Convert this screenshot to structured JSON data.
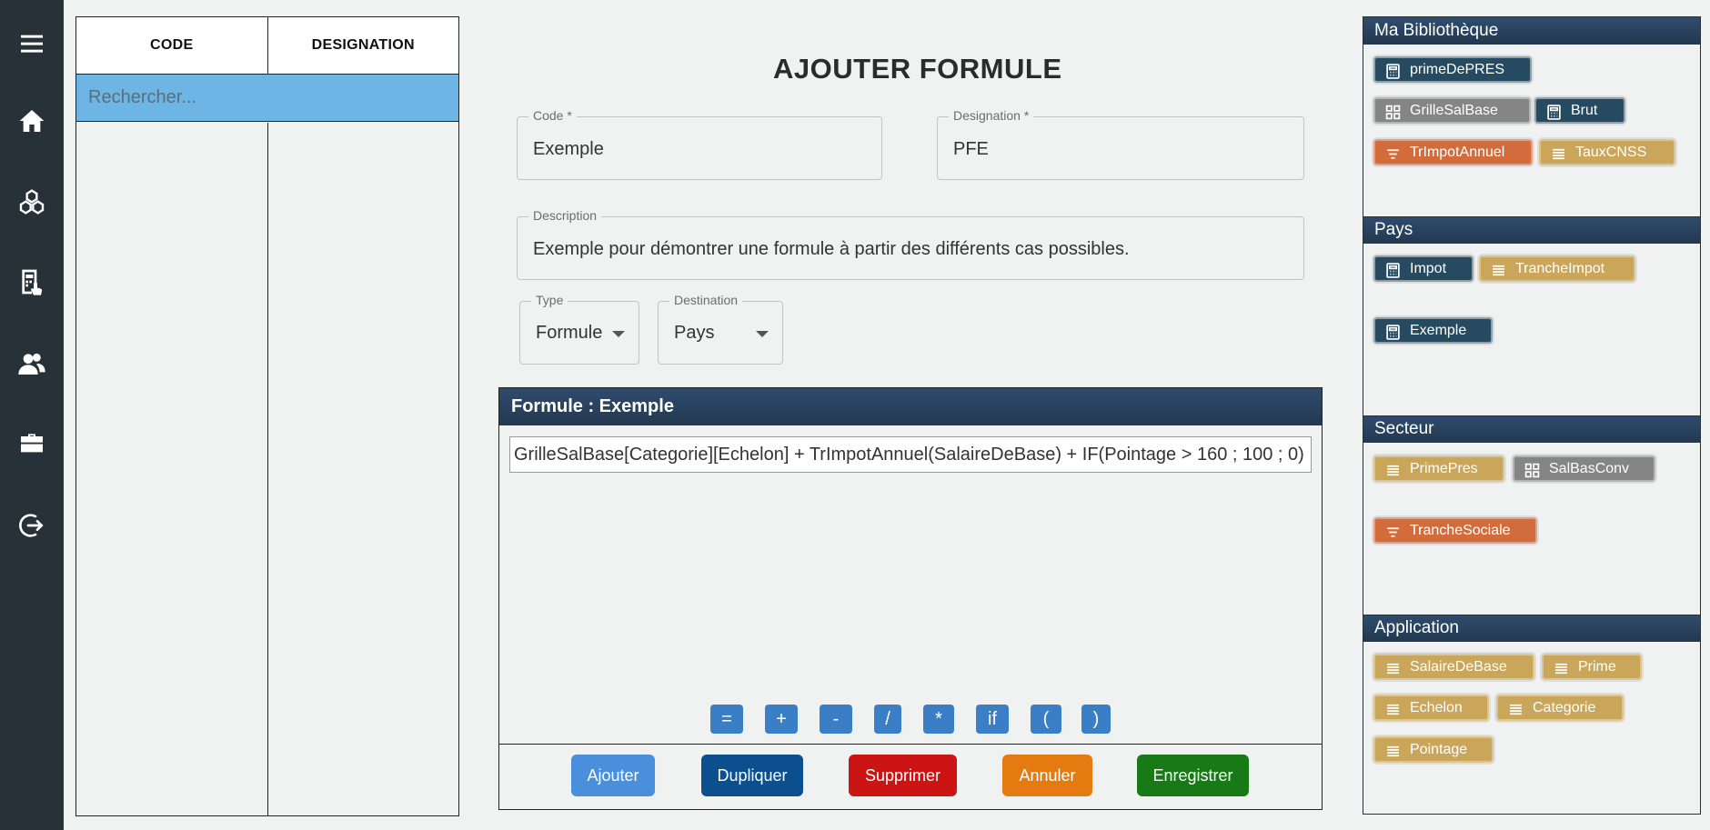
{
  "nav": {
    "items": [
      "menu-icon",
      "home-icon",
      "cubes-icon",
      "calculator-icon",
      "users-icon",
      "briefcase-icon",
      "logout-icon"
    ]
  },
  "table": {
    "col_code": "CODE",
    "col_designation": "DESIGNATION",
    "search_placeholder": "Rechercher..."
  },
  "form": {
    "title": "AJOUTER FORMULE",
    "code_label": "Code *",
    "code_value": "Exemple",
    "designation_label": "Designation *",
    "designation_value": "PFE",
    "description_label": "Description",
    "description_value": "Exemple pour démontrer une formule à partir des différents cas possibles.",
    "type_label": "Type",
    "type_value": "Formule",
    "destination_label": "Destination",
    "destination_value": "Pays"
  },
  "formula": {
    "header": "Formule : Exemple",
    "expression": "GrilleSalBase[Categorie][Echelon] + TrImpotAnnuel(SalaireDeBase) + IF(Pointage > 160 ; 100 ; 0)",
    "operators": [
      "=",
      "+",
      "-",
      "/",
      "*",
      "if",
      "(",
      ")"
    ],
    "buttons": {
      "ajouter": "Ajouter",
      "dupliquer": "Dupliquer",
      "supprimer": "Supprimer",
      "annuler": "Annuler",
      "enregistrer": "Enregistrer"
    }
  },
  "colors": {
    "rail": "#263238",
    "panel_header": "#2a4462",
    "search_bg": "#6cb5e4",
    "btn_ajouter": "#4a8fdc",
    "btn_dupliquer": "#0b4f8f",
    "btn_supprimer": "#cc1414",
    "btn_annuler": "#e57a10",
    "btn_enregistrer": "#177a17",
    "chip_navy": "#264b61",
    "chip_grey": "#858585",
    "chip_orange": "#d36c3d",
    "chip_gold": "#c9a65a"
  },
  "library": {
    "sections": [
      {
        "title": "Ma Bibliothèque",
        "chips": [
          {
            "label": "primeDePRES",
            "kind": "formula",
            "icon": "calculator-icon"
          },
          {
            "label": "GrilleSalBase",
            "kind": "grid",
            "icon": "grid-icon"
          },
          {
            "label": "Brut",
            "kind": "formula",
            "icon": "calculator-icon"
          },
          {
            "label": "TrImpotAnnuel",
            "kind": "tranche",
            "icon": "tranche-icon"
          },
          {
            "label": "TauxCNSS",
            "kind": "constant",
            "icon": "list-icon"
          }
        ]
      },
      {
        "title": "Pays",
        "chips": [
          {
            "label": "Impot",
            "kind": "formula",
            "icon": "calculator-icon"
          },
          {
            "label": "TrancheImpot",
            "kind": "constant",
            "icon": "list-icon"
          },
          {
            "label": "Exemple",
            "kind": "formula",
            "icon": "calculator-icon"
          }
        ]
      },
      {
        "title": "Secteur",
        "chips": [
          {
            "label": "PrimePres",
            "kind": "constant",
            "icon": "list-icon"
          },
          {
            "label": "SalBasConv",
            "kind": "grid",
            "icon": "grid-icon"
          },
          {
            "label": "TrancheSociale",
            "kind": "tranche",
            "icon": "tranche-icon"
          }
        ]
      },
      {
        "title": "Application",
        "chips": [
          {
            "label": "SalaireDeBase",
            "kind": "constant",
            "icon": "list-icon"
          },
          {
            "label": "Prime",
            "kind": "constant",
            "icon": "list-icon"
          },
          {
            "label": "Echelon",
            "kind": "constant",
            "icon": "list-icon"
          },
          {
            "label": "Categorie",
            "kind": "constant",
            "icon": "list-icon"
          },
          {
            "label": "Pointage",
            "kind": "constant",
            "icon": "list-icon"
          }
        ]
      }
    ]
  }
}
